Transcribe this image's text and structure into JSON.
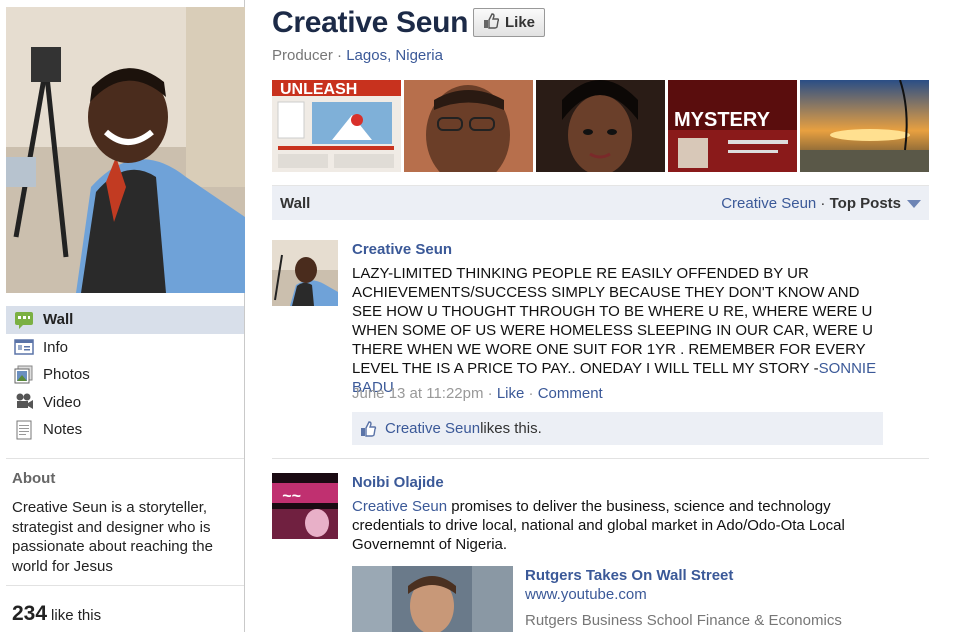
{
  "page": {
    "title": "Creative Seun",
    "like_label": "Like",
    "category": "Producer",
    "separator": " · ",
    "location": "Lagos, Nigeria"
  },
  "nav": [
    {
      "label": "Wall",
      "icon": "wall-icon"
    },
    {
      "label": "Info",
      "icon": "info-icon"
    },
    {
      "label": "Photos",
      "icon": "photos-icon"
    },
    {
      "label": "Video",
      "icon": "video-icon"
    },
    {
      "label": "Notes",
      "icon": "notes-icon"
    }
  ],
  "about": {
    "title": "About",
    "text": "Creative Seun is a storyteller, strategist and designer who is passionate about reaching the world for Jesus"
  },
  "likes": {
    "count": "234",
    "label": "like this"
  },
  "photo_strip": {
    "photo1_text": "UNLEASH",
    "photo4_text": "MYSTERY"
  },
  "wall_bar": {
    "title": "Wall",
    "filter_name": "Creative Seun",
    "separator": " · ",
    "filter_mode": "Top Posts"
  },
  "posts": [
    {
      "author": "Creative Seun",
      "body": "LAZY-LIMITED THINKING PEOPLE RE EASILY OFFENDED BY UR ACHIEVEMENTS/SUCCESS SIMPLY BECAUSE THEY DON'T KNOW AND SEE HOW U THOUGHT THROUGH TO BE WHERE U RE, WHERE WERE U WHEN SOME OF US WERE HOMELESS SLEEPING IN OUR CAR, WERE U THERE WHEN WE WORE ONE SUIT FOR 1YR . REMEMBER FOR EVERY LEVEL THE IS A PRICE TO PAY.. ONEDAY I WILL TELL MY STORY -",
      "body_link": "SONNIE BADU",
      "timestamp": "June 13 at 11:22pm",
      "sep": " · ",
      "like_action": "Like",
      "comment_action": "Comment",
      "likes_name": "Creative Seun",
      "likes_suffix": " likes this."
    },
    {
      "author": "Noibi Olajide",
      "body_link": "Creative Seun",
      "body": " promises to deliver the business, science and technology credentials to drive local, national and global market in Ado/Odo-Ota Local Governemnt of Nigeria.",
      "link_title": "Rutgers Takes On Wall Street",
      "link_url": "www.youtube.com",
      "link_desc": "Rutgers Business School Finance & Economics"
    }
  ],
  "colors": {
    "link": "#3b5998",
    "title": "#1c2a47",
    "nav_active_bg": "#d8dfea",
    "bar_bg": "#eceff5"
  }
}
